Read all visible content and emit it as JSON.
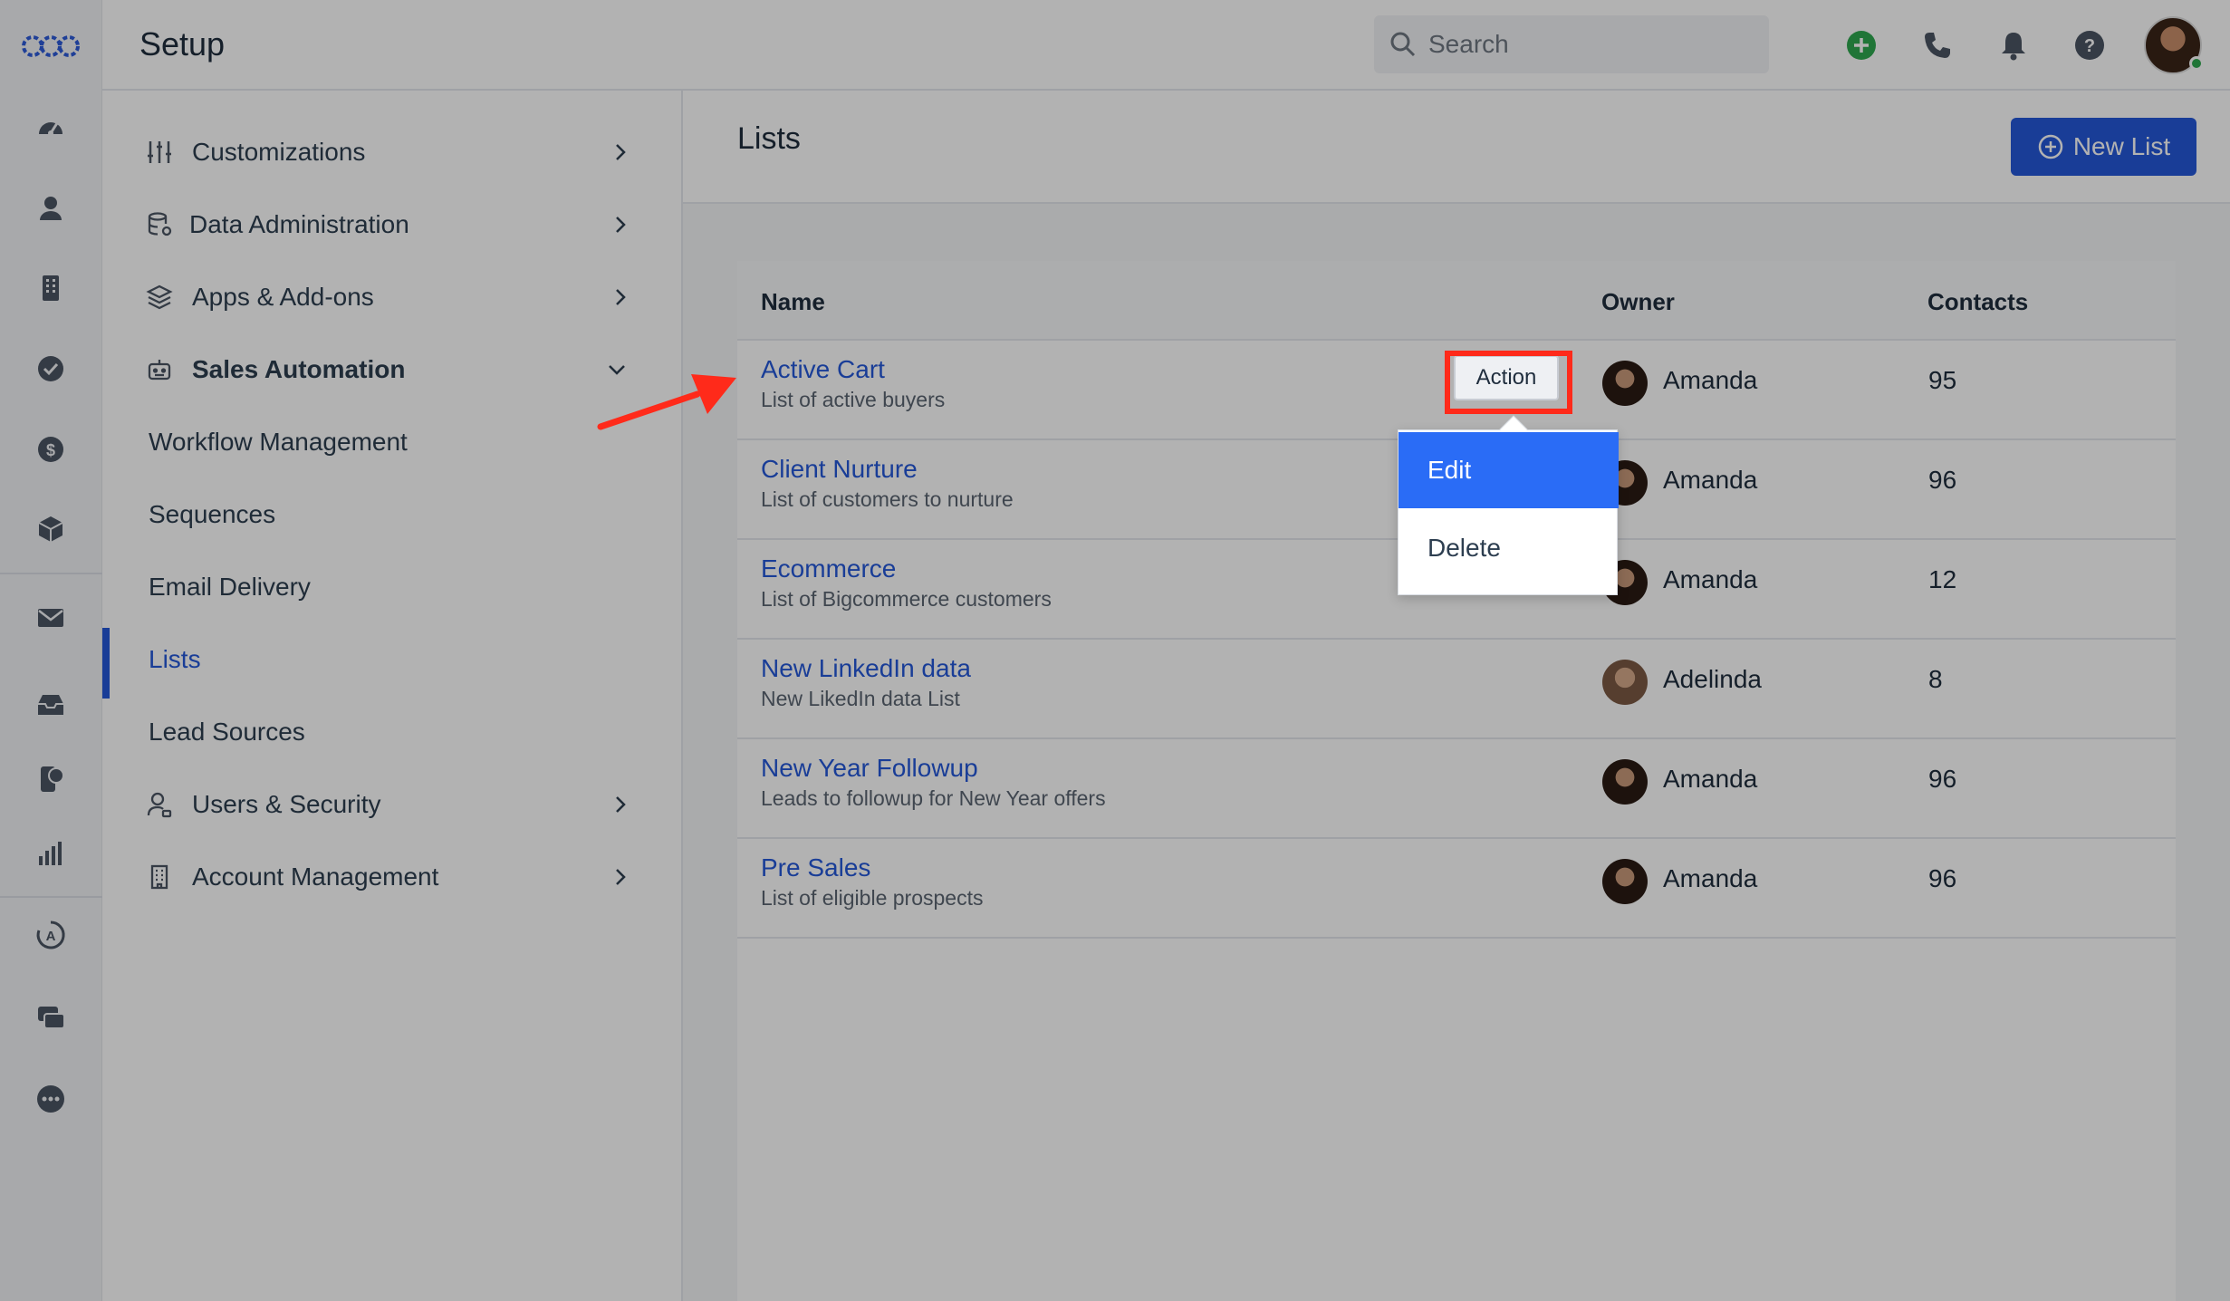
{
  "header": {
    "title": "Setup",
    "search_placeholder": "Search"
  },
  "settings_nav": {
    "items": [
      {
        "label": "Customizations",
        "expanded": false
      },
      {
        "label": "Data Administration",
        "expanded": false
      },
      {
        "label": "Apps & Add-ons",
        "expanded": false
      },
      {
        "label": "Sales Automation",
        "expanded": true
      },
      {
        "label": "Workflow Management"
      },
      {
        "label": "Sequences"
      },
      {
        "label": "Email Delivery"
      },
      {
        "label": "Lists",
        "active": true
      },
      {
        "label": "Lead Sources"
      },
      {
        "label": "Users & Security",
        "expanded": false
      },
      {
        "label": "Account Management",
        "expanded": false
      }
    ]
  },
  "main": {
    "title": "Lists",
    "new_button": "New List",
    "columns": {
      "name": "Name",
      "owner": "Owner",
      "contacts": "Contacts"
    },
    "rows": [
      {
        "name": "Active Cart",
        "description": "List of active buyers",
        "owner": "Amanda",
        "contacts": "95"
      },
      {
        "name": "Client Nurture",
        "description": "List of customers to nurture",
        "owner": "Amanda",
        "contacts": "96"
      },
      {
        "name": "Ecommerce",
        "description": "List of Bigcommerce customers",
        "owner": "Amanda",
        "contacts": "12"
      },
      {
        "name": "New LinkedIn data",
        "description": "New LikedIn data List",
        "owner": "Adelinda",
        "contacts": "8"
      },
      {
        "name": "New Year Followup",
        "description": "Leads to followup for New Year offers",
        "owner": "Amanda",
        "contacts": "96"
      },
      {
        "name": "Pre Sales",
        "description": "List of eligible prospects",
        "owner": "Amanda",
        "contacts": "96"
      }
    ],
    "action_button": "Action",
    "action_menu": {
      "edit": "Edit",
      "delete": "Delete"
    }
  },
  "colors": {
    "accent": "#2558d8",
    "menu_selected": "#2a6cf6",
    "highlight": "#ff2a1a",
    "add_icon": "#2fa84f"
  },
  "icons": {
    "rail": [
      "dashboard-icon",
      "contacts-icon",
      "companies-icon",
      "tasks-icon",
      "deals-icon",
      "products-icon",
      "email-icon",
      "inbox-icon",
      "chat-icon",
      "reports-icon",
      "automation-icon",
      "conversations-icon",
      "more-icon"
    ],
    "header": [
      "add-icon",
      "phone-icon",
      "bell-icon",
      "help-icon"
    ]
  }
}
